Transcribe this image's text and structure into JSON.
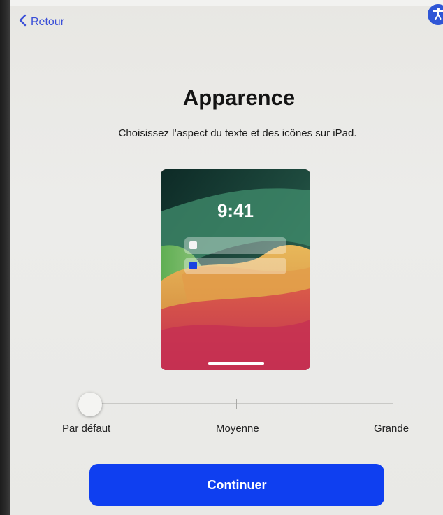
{
  "nav": {
    "back_label": "Retour",
    "back_icon": "chevron-left-icon",
    "accessibility_icon": "accessibility-icon"
  },
  "header": {
    "title": "Apparence",
    "subtitle": "Choisissez l’aspect du texte et des icônes sur iPad."
  },
  "preview": {
    "time": "9:41",
    "notification_dot_colors": [
      "#f4f4f4",
      "#1a44e0"
    ]
  },
  "size_slider": {
    "options": [
      "Par défaut",
      "Moyenne",
      "Grande"
    ],
    "selected": "Par défaut",
    "selected_index": 0
  },
  "footer": {
    "continue_label": "Continuer"
  },
  "colors": {
    "accent": "#0f3ff0",
    "link": "#3a4fd8",
    "background": "#e9e9e6"
  }
}
